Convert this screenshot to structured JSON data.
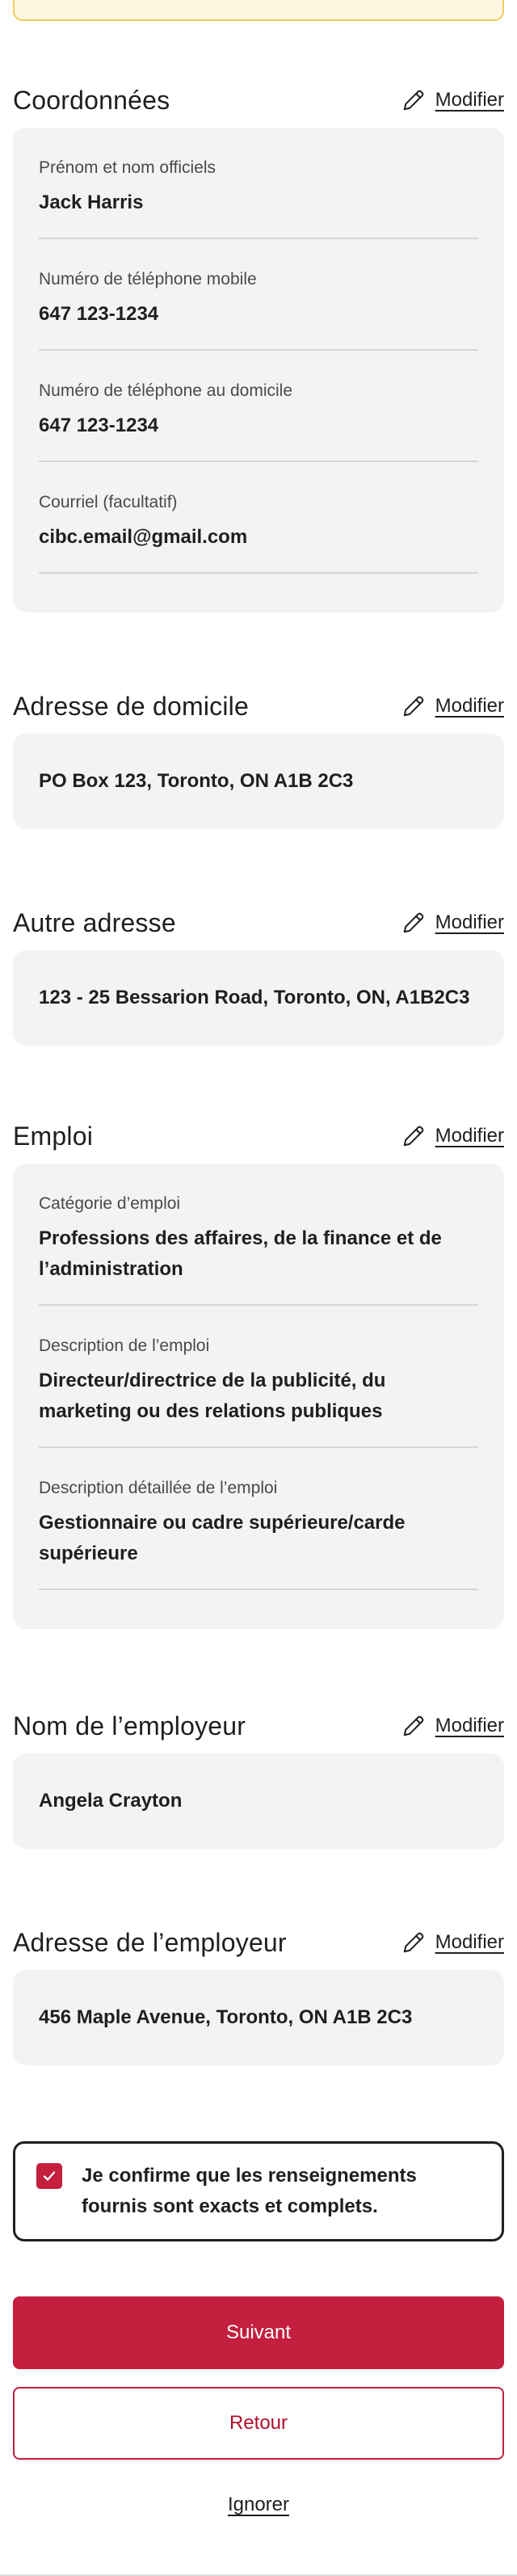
{
  "edit_label": "Modifier",
  "sections": {
    "coordonnees": {
      "title": "Coordonnées",
      "fields": [
        {
          "label": "Prénom et nom officiels",
          "value": "Jack Harris"
        },
        {
          "label": "Numéro de téléphone mobile",
          "value": "647 123-1234"
        },
        {
          "label": "Numéro de téléphone au domicile",
          "value": "647 123-1234"
        },
        {
          "label": "Courriel (facultatif)",
          "value": "cibc.email@gmail.com"
        }
      ]
    },
    "adresse_domicile": {
      "title": "Adresse de domicile",
      "value": "PO Box 123, Toronto, ON A1B 2C3"
    },
    "autre_adresse": {
      "title": "Autre adresse",
      "value": "123 - 25 Bessarion Road, Toronto, ON, A1B2C3"
    },
    "emploi": {
      "title": "Emploi",
      "fields": [
        {
          "label": "Catégorie d’emploi",
          "value": "Professions des affaires, de la finance et de l’administration"
        },
        {
          "label": "Description de l’emploi",
          "value": "Directeur/directrice de la publicité, du marketing ou des relations publiques"
        },
        {
          "label": "Description détaillée de l’emploi",
          "value": "Gestionnaire ou cadre supérieure/carde supérieure"
        }
      ]
    },
    "nom_employeur": {
      "title": "Nom de l’employeur",
      "value": "Angela Crayton"
    },
    "adresse_employeur": {
      "title": "Adresse de l’employeur",
      "value": "456 Maple Avenue, Toronto, ON A1B 2C3"
    }
  },
  "confirm": {
    "text": "Je confirme que les renseignements fournis sont exacts et complets.",
    "checked": true
  },
  "buttons": {
    "next": "Suivant",
    "back": "Retour",
    "ignore": "Ignorer"
  },
  "colors": {
    "brand": "#c41f3e",
    "card_bg": "#f3f3f3",
    "banner_border": "#f2cd58"
  }
}
